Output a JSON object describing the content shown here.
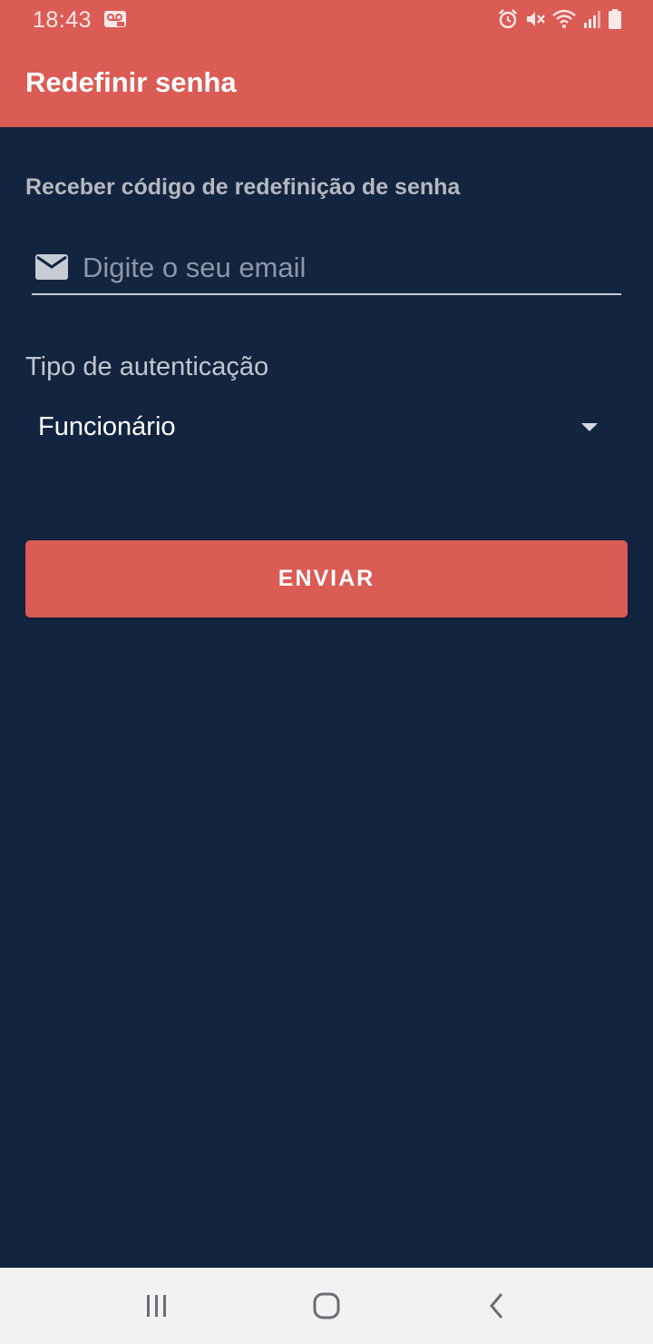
{
  "status_bar": {
    "time": "18:43",
    "icons": [
      "voicemail-icon",
      "alarm-icon",
      "mute-icon",
      "wifi-icon",
      "signal-icon",
      "battery-icon"
    ]
  },
  "app_bar": {
    "title": "Redefinir senha"
  },
  "form": {
    "heading": "Receber código de redefinição de senha",
    "email": {
      "placeholder": "Digite o seu email",
      "value": "",
      "icon": "mail-icon"
    },
    "auth_type": {
      "label": "Tipo de autenticação",
      "selected": "Funcionário",
      "icon": "caret-down-icon"
    },
    "submit_label": "ENVIAR"
  },
  "nav_bar": {
    "buttons": [
      "recents-icon",
      "home-icon",
      "back-icon"
    ]
  },
  "colors": {
    "accent": "#db5b55",
    "background": "#12243f",
    "navbar": "#f2f2f4"
  }
}
